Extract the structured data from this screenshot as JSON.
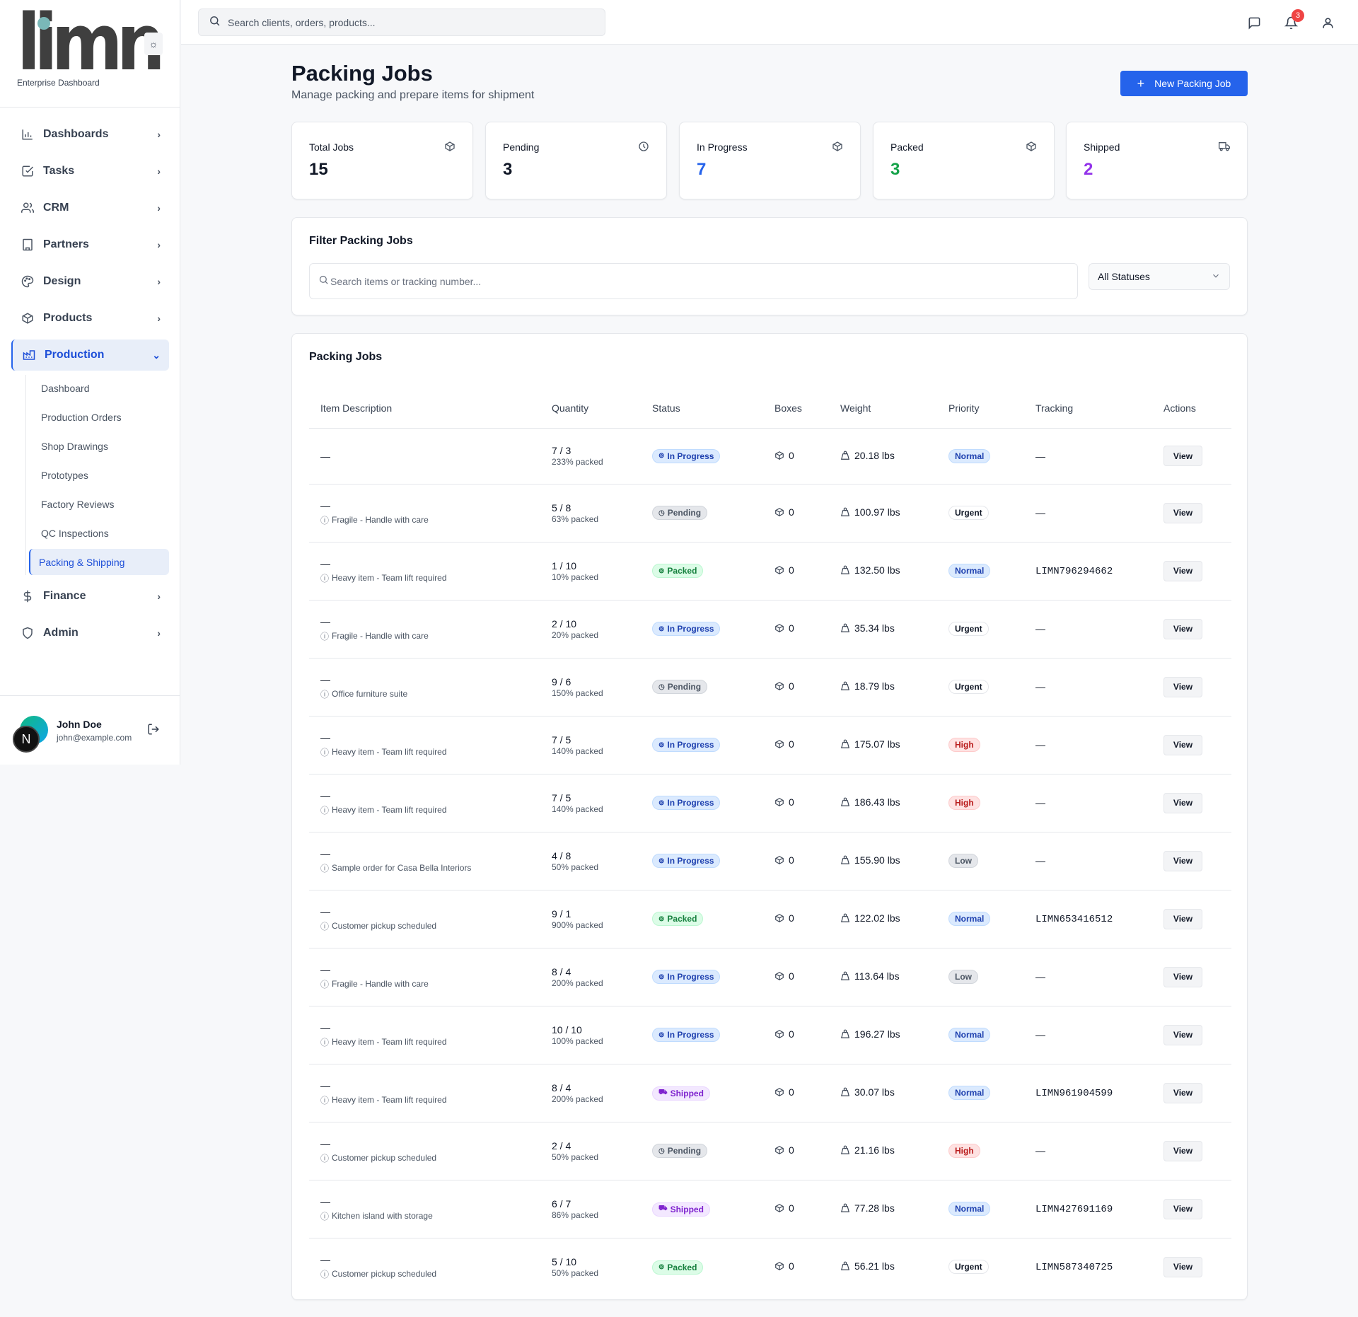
{
  "app": {
    "logo_text": "limn",
    "subtitle": "Enterprise Dashboard"
  },
  "sidebar": {
    "items": [
      {
        "label": "Dashboards",
        "icon": "bar-chart-icon"
      },
      {
        "label": "Tasks",
        "icon": "check-square-icon"
      },
      {
        "label": "CRM",
        "icon": "users-icon"
      },
      {
        "label": "Partners",
        "icon": "building-icon"
      },
      {
        "label": "Design",
        "icon": "palette-icon"
      },
      {
        "label": "Products",
        "icon": "package-icon"
      },
      {
        "label": "Production",
        "icon": "factory-icon",
        "active": true
      },
      {
        "label": "Finance",
        "icon": "dollar-icon"
      },
      {
        "label": "Admin",
        "icon": "shield-icon"
      }
    ],
    "production_sub": [
      {
        "label": "Dashboard"
      },
      {
        "label": "Production Orders"
      },
      {
        "label": "Shop Drawings"
      },
      {
        "label": "Prototypes"
      },
      {
        "label": "Factory Reviews"
      },
      {
        "label": "QC Inspections"
      },
      {
        "label": "Packing & Shipping",
        "active": true
      }
    ],
    "user": {
      "name": "John Doe",
      "email": "john@example.com",
      "avatar_letter": "N"
    }
  },
  "topbar": {
    "search_placeholder": "Search clients, orders, products...",
    "notification_count": "3"
  },
  "page": {
    "title": "Packing Jobs",
    "subtitle": "Manage packing and prepare items for shipment",
    "new_button": "New Packing Job"
  },
  "stats": [
    {
      "label": "Total Jobs",
      "value": "15",
      "color": "#111827",
      "icon": "package-icon"
    },
    {
      "label": "Pending",
      "value": "3",
      "color": "#111827",
      "icon": "clock-icon"
    },
    {
      "label": "In Progress",
      "value": "7",
      "color": "#2563eb",
      "icon": "package-icon"
    },
    {
      "label": "Packed",
      "value": "3",
      "color": "#16a34a",
      "icon": "package-icon"
    },
    {
      "label": "Shipped",
      "value": "2",
      "color": "#9333ea",
      "icon": "truck-icon"
    }
  ],
  "filter": {
    "title": "Filter Packing Jobs",
    "search_placeholder": "Search items or tracking number...",
    "status_selected": "All Statuses"
  },
  "table": {
    "title": "Packing Jobs",
    "columns": [
      "Item Description",
      "Quantity",
      "Status",
      "Boxes",
      "Weight",
      "Priority",
      "Tracking",
      "Actions"
    ],
    "view_label": "View",
    "rows": [
      {
        "desc": "—",
        "note": "",
        "qty": "7 / 3",
        "packed": "233% packed",
        "status": "In Progress",
        "boxes": "0",
        "weight": "20.18 lbs",
        "priority": "Normal",
        "tracking": "—"
      },
      {
        "desc": "—",
        "note": "Fragile - Handle with care",
        "qty": "5 / 8",
        "packed": "63% packed",
        "status": "Pending",
        "boxes": "0",
        "weight": "100.97 lbs",
        "priority": "Urgent",
        "tracking": "—"
      },
      {
        "desc": "—",
        "note": "Heavy item - Team lift required",
        "qty": "1 / 10",
        "packed": "10% packed",
        "status": "Packed",
        "boxes": "0",
        "weight": "132.50 lbs",
        "priority": "Normal",
        "tracking": "LIMN796294662"
      },
      {
        "desc": "—",
        "note": "Fragile - Handle with care",
        "qty": "2 / 10",
        "packed": "20% packed",
        "status": "In Progress",
        "boxes": "0",
        "weight": "35.34 lbs",
        "priority": "Urgent",
        "tracking": "—"
      },
      {
        "desc": "—",
        "note": "Office furniture suite",
        "qty": "9 / 6",
        "packed": "150% packed",
        "status": "Pending",
        "boxes": "0",
        "weight": "18.79 lbs",
        "priority": "Urgent",
        "tracking": "—"
      },
      {
        "desc": "—",
        "note": "Heavy item - Team lift required",
        "qty": "7 / 5",
        "packed": "140% packed",
        "status": "In Progress",
        "boxes": "0",
        "weight": "175.07 lbs",
        "priority": "High",
        "tracking": "—"
      },
      {
        "desc": "—",
        "note": "Heavy item - Team lift required",
        "qty": "7 / 5",
        "packed": "140% packed",
        "status": "In Progress",
        "boxes": "0",
        "weight": "186.43 lbs",
        "priority": "High",
        "tracking": "—"
      },
      {
        "desc": "—",
        "note": "Sample order for Casa Bella Interiors",
        "qty": "4 / 8",
        "packed": "50% packed",
        "status": "In Progress",
        "boxes": "0",
        "weight": "155.90 lbs",
        "priority": "Low",
        "tracking": "—"
      },
      {
        "desc": "—",
        "note": "Customer pickup scheduled",
        "qty": "9 / 1",
        "packed": "900% packed",
        "status": "Packed",
        "boxes": "0",
        "weight": "122.02 lbs",
        "priority": "Normal",
        "tracking": "LIMN653416512"
      },
      {
        "desc": "—",
        "note": "Fragile - Handle with care",
        "qty": "8 / 4",
        "packed": "200% packed",
        "status": "In Progress",
        "boxes": "0",
        "weight": "113.64 lbs",
        "priority": "Low",
        "tracking": "—"
      },
      {
        "desc": "—",
        "note": "Heavy item - Team lift required",
        "qty": "10 / 10",
        "packed": "100% packed",
        "status": "In Progress",
        "boxes": "0",
        "weight": "196.27 lbs",
        "priority": "Normal",
        "tracking": "—"
      },
      {
        "desc": "—",
        "note": "Heavy item - Team lift required",
        "qty": "8 / 4",
        "packed": "200% packed",
        "status": "Shipped",
        "boxes": "0",
        "weight": "30.07 lbs",
        "priority": "Normal",
        "tracking": "LIMN961904599"
      },
      {
        "desc": "—",
        "note": "Customer pickup scheduled",
        "qty": "2 / 4",
        "packed": "50% packed",
        "status": "Pending",
        "boxes": "0",
        "weight": "21.16 lbs",
        "priority": "High",
        "tracking": "—"
      },
      {
        "desc": "—",
        "note": "Kitchen island with storage",
        "qty": "6 / 7",
        "packed": "86% packed",
        "status": "Shipped",
        "boxes": "0",
        "weight": "77.28 lbs",
        "priority": "Normal",
        "tracking": "LIMN427691169"
      },
      {
        "desc": "—",
        "note": "Customer pickup scheduled",
        "qty": "5 / 10",
        "packed": "50% packed",
        "status": "Packed",
        "boxes": "0",
        "weight": "56.21 lbs",
        "priority": "Urgent",
        "tracking": "LIMN587340725"
      }
    ]
  }
}
